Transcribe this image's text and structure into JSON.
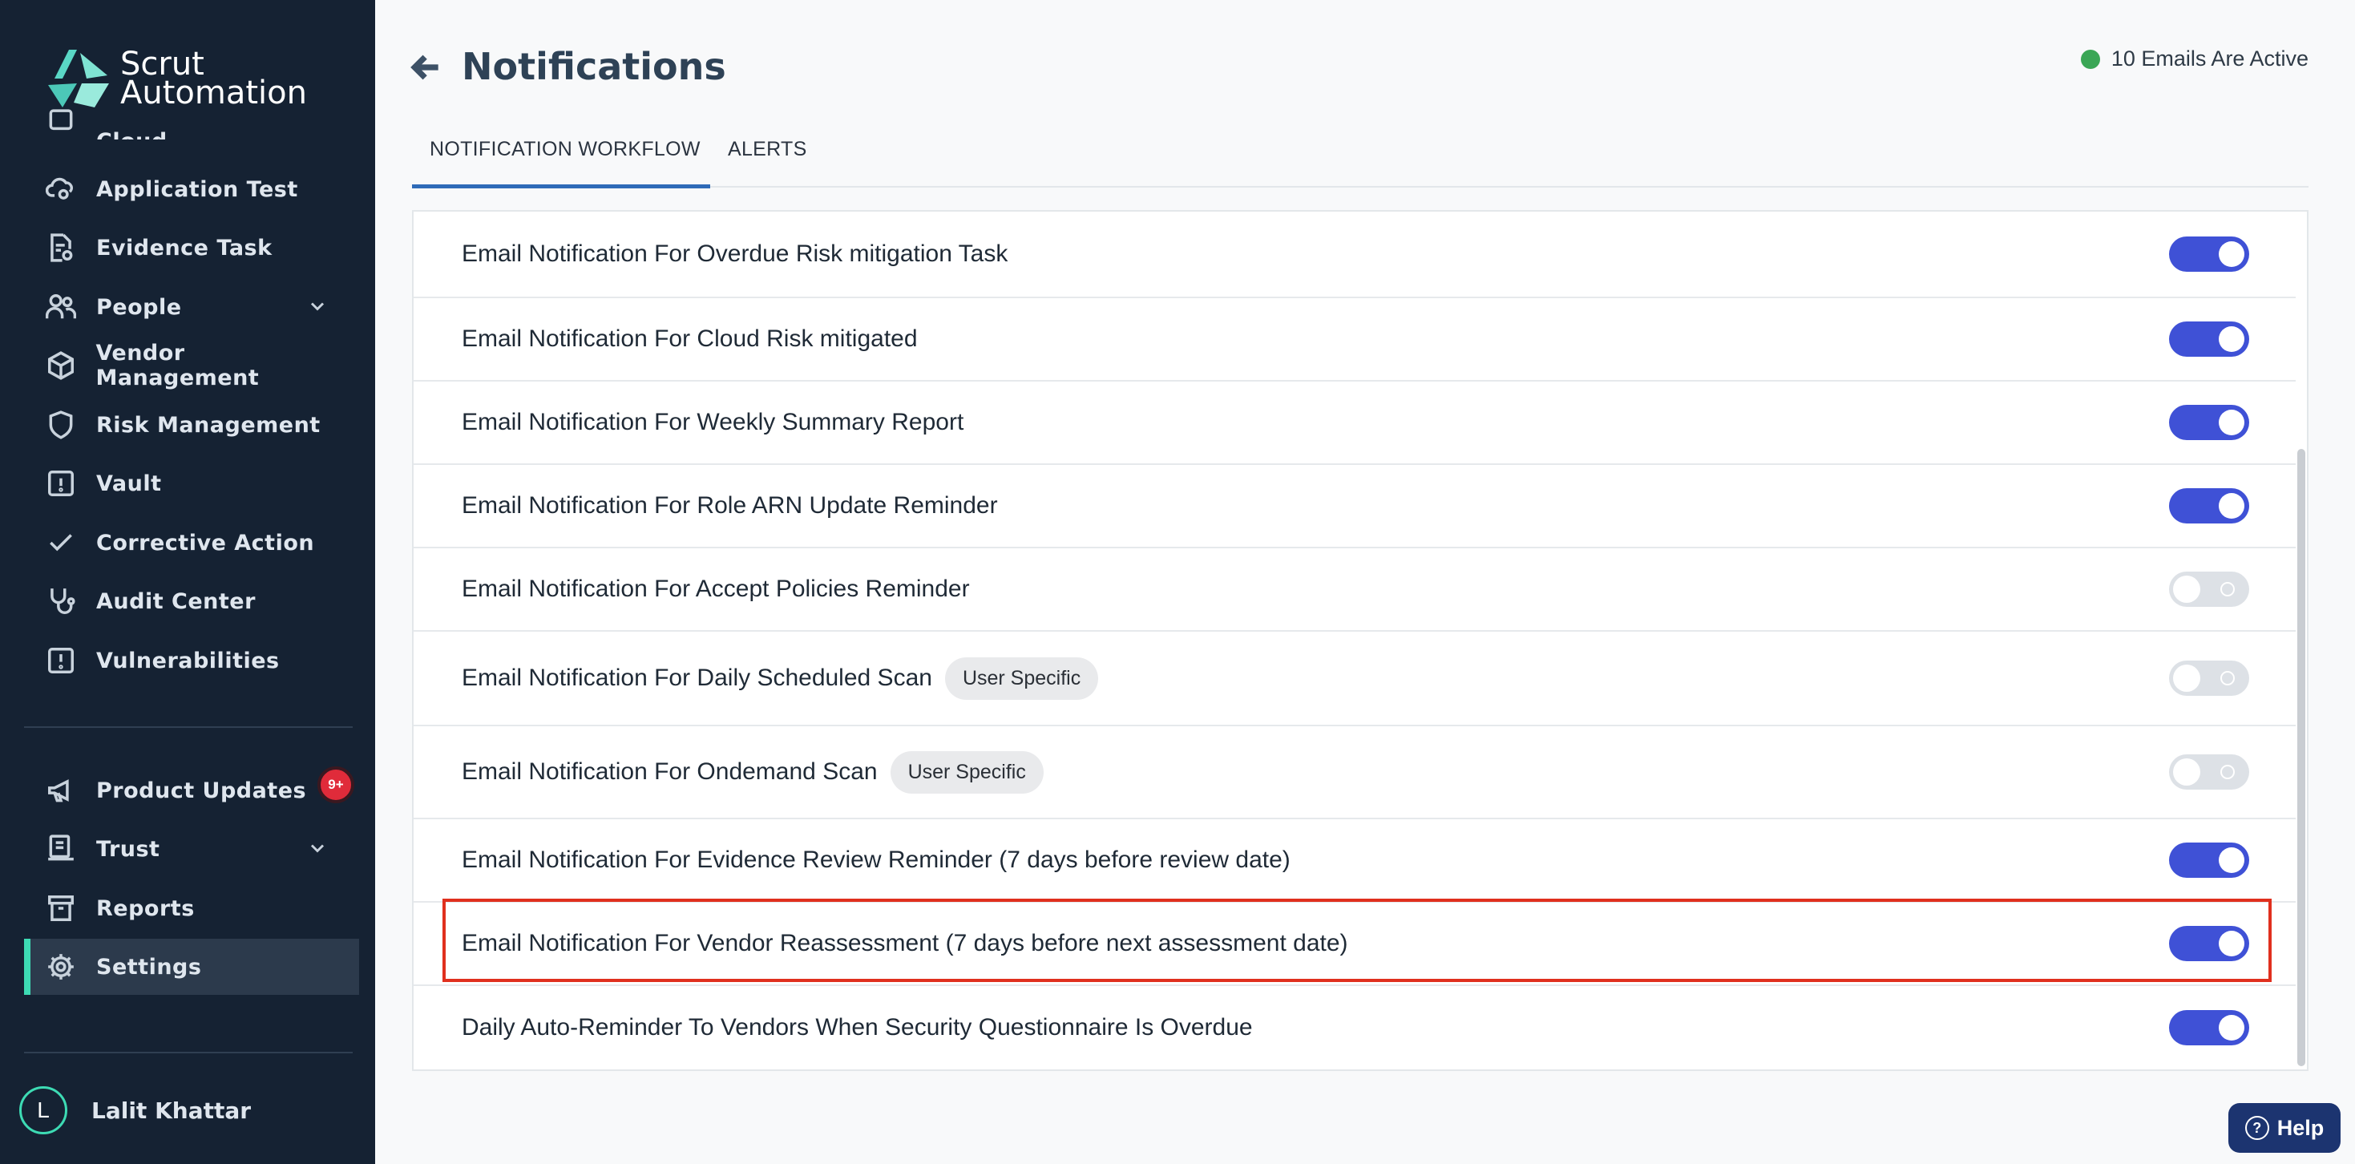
{
  "app": {
    "logo_line1": "Scrut",
    "logo_line2": "Automation"
  },
  "sidebar": {
    "partial_item": "Cloud",
    "items": [
      {
        "label": "Application Test",
        "icon": "cloud-gear-icon"
      },
      {
        "label": "Evidence Task",
        "icon": "document-check-icon"
      },
      {
        "label": "People",
        "icon": "people-icon",
        "expandable": true
      },
      {
        "label": "Vendor Management",
        "icon": "box-icon"
      },
      {
        "label": "Risk Management",
        "icon": "shield-icon"
      },
      {
        "label": "Vault",
        "icon": "vault-icon"
      },
      {
        "label": "Corrective Action",
        "icon": "check-icon"
      },
      {
        "label": "Audit Center",
        "icon": "stethoscope-icon"
      },
      {
        "label": "Vulnerabilities",
        "icon": "alert-square-icon"
      }
    ],
    "bottom_items": [
      {
        "label": "Product Updates",
        "icon": "megaphone-icon",
        "badge": "9+"
      },
      {
        "label": "Trust",
        "icon": "trust-icon",
        "expandable": true
      },
      {
        "label": "Reports",
        "icon": "archive-icon"
      },
      {
        "label": "Settings",
        "icon": "gear-icon",
        "active": true
      }
    ],
    "user": {
      "initial": "L",
      "name": "Lalit Khattar"
    }
  },
  "header": {
    "title": "Notifications",
    "status_text": "10 Emails Are Active",
    "status_color": "#3aa655"
  },
  "tabs": [
    {
      "label": "NOTIFICATION WORKFLOW",
      "active": true
    },
    {
      "label": "ALERTS",
      "active": false
    }
  ],
  "notifications": [
    {
      "label": "Email Notification For Overdue Risk mitigation Task",
      "enabled": true
    },
    {
      "label": "Email Notification For Cloud Risk mitigated",
      "enabled": true
    },
    {
      "label": "Email Notification For Weekly Summary Report",
      "enabled": true
    },
    {
      "label": "Email Notification For Role ARN Update Reminder",
      "enabled": true
    },
    {
      "label": "Email Notification For Accept Policies Reminder",
      "enabled": false
    },
    {
      "label": "Email Notification For Daily Scheduled Scan",
      "tag": "User Specific",
      "enabled": false
    },
    {
      "label": "Email Notification For Ondemand Scan",
      "tag": "User Specific",
      "enabled": false
    },
    {
      "label": "Email Notification For Evidence Review Reminder (7 days before review date)",
      "enabled": true
    },
    {
      "label": "Email Notification For Vendor Reassessment (7 days before next assessment date)",
      "enabled": true,
      "highlighted": true
    },
    {
      "label": "Daily Auto-Reminder To Vendors When Security Questionnaire Is Overdue",
      "enabled": true
    }
  ],
  "help": {
    "label": "Help"
  },
  "colors": {
    "sidebar_bg": "#152233",
    "accent": "#3ddbb4",
    "toggle_on": "#3f51d6",
    "highlight": "#e0301e"
  }
}
